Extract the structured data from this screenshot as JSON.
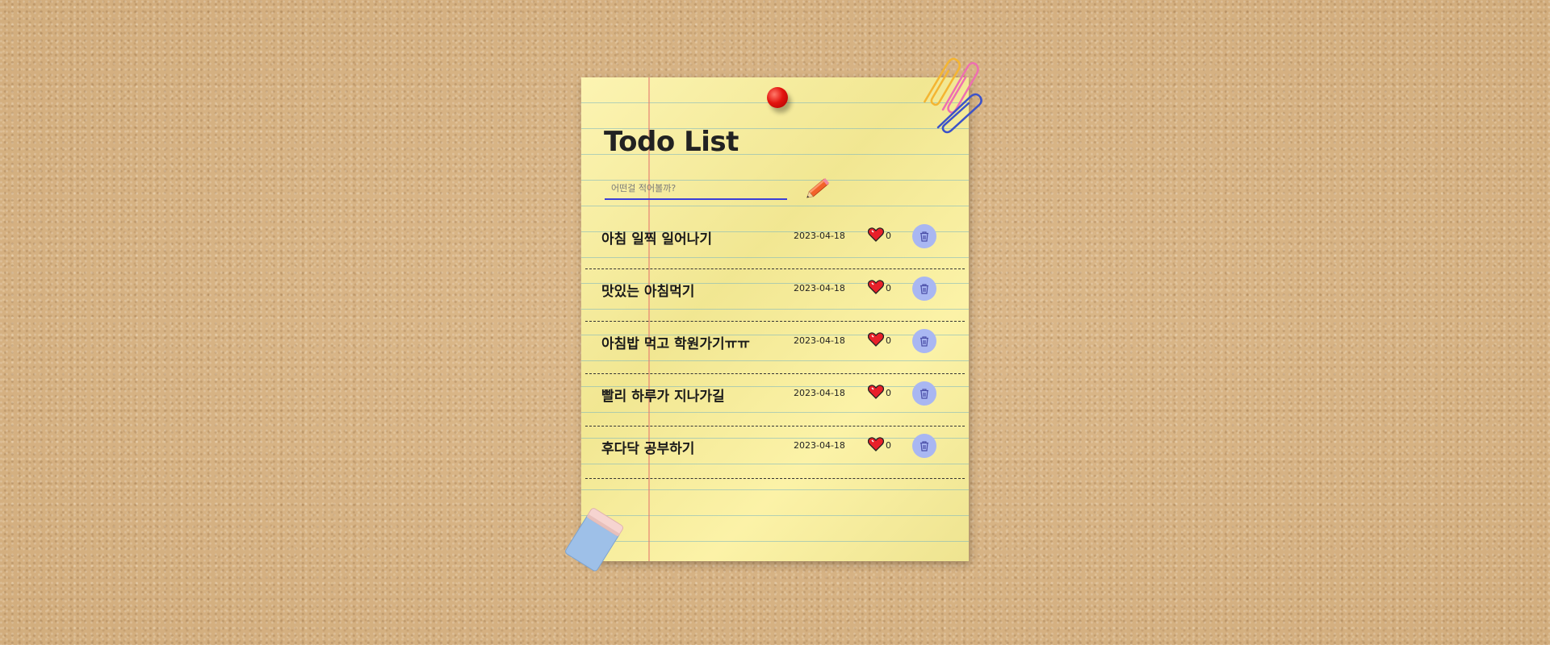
{
  "app": {
    "title": "Todo List"
  },
  "input": {
    "placeholder": "어떤걸 적어볼까?",
    "value": ""
  },
  "icons": {
    "add": "pencil-icon",
    "like": "heart-icon",
    "delete": "trash-icon",
    "pin": "pushpin-icon",
    "clips": "paperclip-icon",
    "eraser": "eraser-icon"
  },
  "todos": [
    {
      "text": "아침 일찍 일어나기",
      "date": "2023-04-18",
      "likes": "0"
    },
    {
      "text": "맛있는 아침먹기",
      "date": "2023-04-18",
      "likes": "0"
    },
    {
      "text": "아침밥 먹고 학원가기ㅠㅠ",
      "date": "2023-04-18",
      "likes": "0"
    },
    {
      "text": "빨리 하루가 지나가길",
      "date": "2023-04-18",
      "likes": "0"
    },
    {
      "text": "후다닥 공부하기",
      "date": "2023-04-18",
      "likes": "0"
    }
  ],
  "colors": {
    "background": "#d9b688",
    "paper": "#fbf098",
    "pin": "#e3140f",
    "input_underline": "#3b3fd6",
    "delete_button": "#a9b7f2",
    "heart": "#e8202a"
  }
}
